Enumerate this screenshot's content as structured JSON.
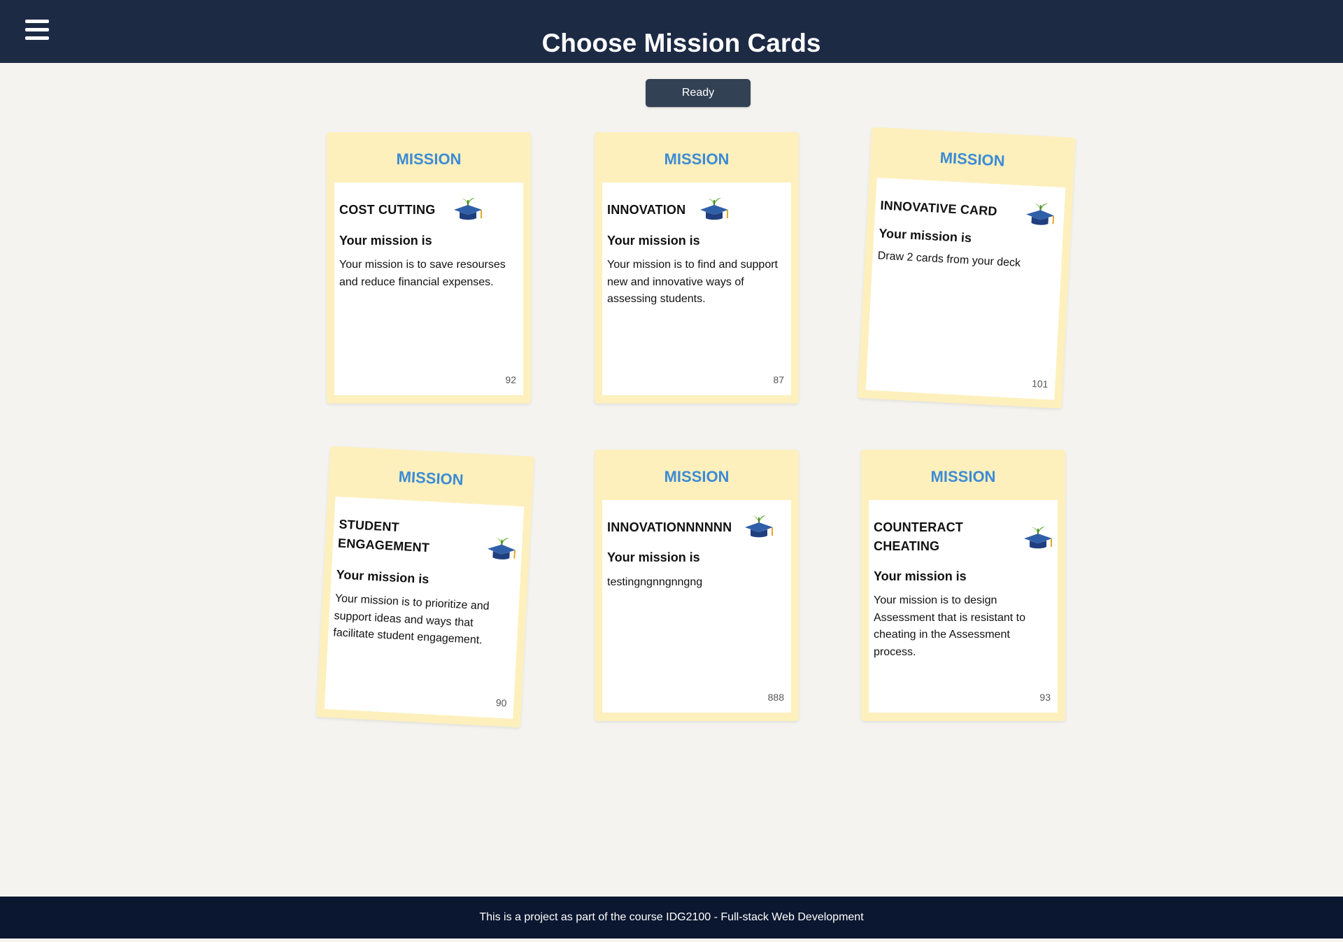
{
  "header": {
    "title": "Choose Mission Cards",
    "menu_icon": "hamburger-menu-icon"
  },
  "ready_button": {
    "label": "Ready"
  },
  "cards": [
    {
      "header": "MISSION",
      "title": "COST CUTTING",
      "subtitle": "Your mission is",
      "text": "Your mission is to save resourses and reduce financial expenses.",
      "number": "92",
      "icon": "graduation-cap-plant-icon"
    },
    {
      "header": "MISSION",
      "title": "INNOVATION",
      "subtitle": "Your mission is",
      "text": "Your mission is to find and support new and innovative ways of assessing students.",
      "number": "87",
      "icon": "graduation-cap-plant-icon"
    },
    {
      "header": "MISSION",
      "title": "INNOVATIVE CARD",
      "subtitle": "Your mission is",
      "text": "Draw 2 cards from your deck",
      "number": "101",
      "icon": "graduation-cap-plant-icon"
    },
    {
      "header": "MISSION",
      "title": "STUDENT ENGAGEMENT",
      "subtitle": "Your mission is",
      "text": "Your mission is to prioritize and support ideas and ways that facilitate student engagement.",
      "number": "90",
      "icon": "graduation-cap-plant-icon"
    },
    {
      "header": "MISSION",
      "title": "INNOVATIONNNNNN",
      "subtitle": "Your mission is",
      "text": "testingngnngnngng",
      "number": "888",
      "icon": "graduation-cap-plant-icon"
    },
    {
      "header": "MISSION",
      "title": "COUNTERACT CHEATING",
      "subtitle": "Your mission is",
      "text": "Your mission is to design Assessment that is resistant to cheating in the Assessment process.",
      "number": "93",
      "icon": "graduation-cap-plant-icon"
    }
  ],
  "footer": {
    "text": "This is a project as part of the course IDG2100 - Full-stack Web Development"
  },
  "colors": {
    "header_bg": "#1d2a44",
    "footer_bg": "#0b1730",
    "card_bg": "#fdf0bd",
    "mission_blue": "#3d8bd4",
    "button_bg": "#334155"
  }
}
